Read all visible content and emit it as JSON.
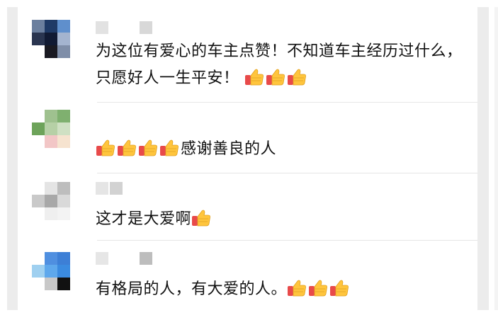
{
  "comments": [
    {
      "text_before": "为这位有爱心的车主点赞！不知道车主经历过什么，只愿好人一生平安！",
      "thumbs_before": 0,
      "thumbs_after": 3,
      "text_after": ""
    },
    {
      "text_before": "",
      "thumbs_before": 4,
      "thumbs_after": 0,
      "text_after": "感谢善良的人"
    },
    {
      "text_before": "这才是大爱啊",
      "thumbs_before": 0,
      "thumbs_after": 1,
      "text_after": ""
    },
    {
      "text_before": "有格局的人，有大爱的人。",
      "thumbs_before": 0,
      "thumbs_after": 3,
      "text_after": ""
    }
  ],
  "icons": {
    "thumbs_up": "thumbs-up-icon"
  },
  "colors": {
    "thumb_skin": "#ffc53d",
    "thumb_cuff": "#e84a4a",
    "text": "#111111",
    "divider": "#e6e6e6"
  }
}
